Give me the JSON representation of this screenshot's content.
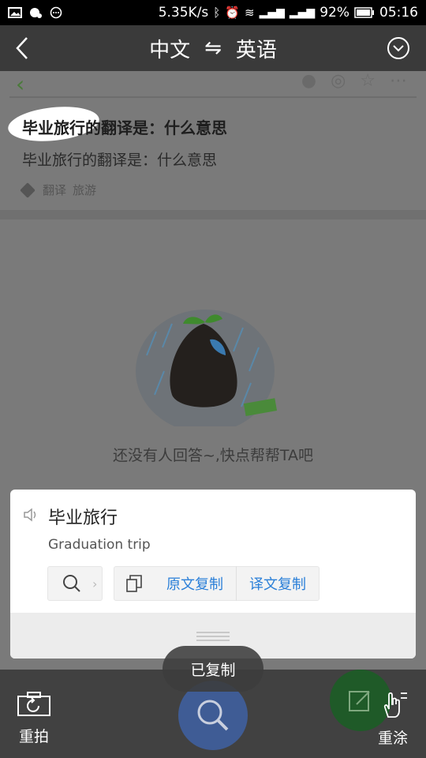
{
  "status": {
    "speed": "5.35K/s",
    "battery": "92%",
    "time": "05:16"
  },
  "topbar": {
    "source_lang": "中文",
    "swap": "⇋",
    "target_lang": "英语"
  },
  "article": {
    "title": "毕业旅行的翻译是：什么意思",
    "subtitle": "毕业旅行的翻译是：什么意思",
    "tags": [
      "翻译",
      "旅游"
    ],
    "empty_text": "还没有人回答~,快点帮帮TA吧"
  },
  "card": {
    "source_text": "毕业旅行",
    "translation": "Graduation trip",
    "copy_source": "原文复制",
    "copy_translation": "译文复制"
  },
  "toast": "已复制",
  "bottombar": {
    "retake": "重拍",
    "repaint": "重涂"
  },
  "colors": {
    "accent_blue": "#2a7fd8",
    "status_bg": "#000000",
    "overlay": "#7a7a7a"
  }
}
